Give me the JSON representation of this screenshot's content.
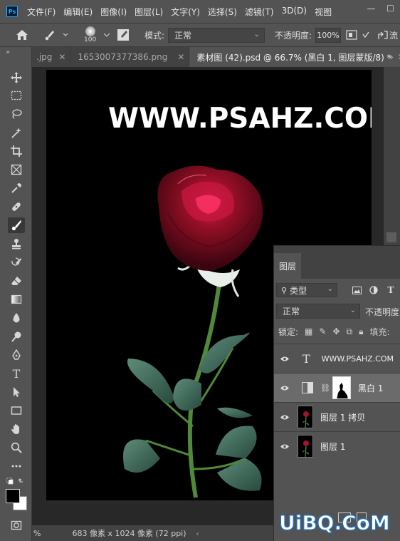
{
  "app": {
    "logo_text": "Ps",
    "menu": [
      "文件(F)",
      "编辑(E)",
      "图像(I)",
      "图层(L)",
      "文字(Y)",
      "选择(S)",
      "滤镜(T)",
      "3D(D)",
      "视图"
    ],
    "window_controls": {
      "minimize": "—",
      "maximize": "☐"
    }
  },
  "options_bar": {
    "brush_size": "100",
    "mode_label": "模式:",
    "mode_value": "正常",
    "opacity_label": "不透明度:",
    "opacity_value": "100%",
    "flow_label": "流"
  },
  "tabs": [
    {
      "label": ".jpg",
      "active": false
    },
    {
      "label": "1653007377386.png",
      "active": false
    },
    {
      "label": "素材图 (42).psd @ 66.7% (黑白 1, 图层蒙版/8) *",
      "active": true
    }
  ],
  "tab_more": "»",
  "canvas": {
    "watermark": "WWW.PSAHZ.COM"
  },
  "status": {
    "zoom_suffix": "%",
    "doc_size": "683 像素 x 1024 像素 (72 ppi)",
    "arrow": "‹"
  },
  "layers_panel": {
    "tab_label": "图层",
    "filter_value": "类型",
    "blend_mode": "正常",
    "opacity_label": "不透明度:",
    "lock_label": "锁定:",
    "fill_label": "填充:",
    "layers": [
      {
        "name": "WWW.PSAHZ.COM",
        "kind": "text",
        "selected": false
      },
      {
        "name": "黑白 1",
        "kind": "adjustment",
        "selected": true
      },
      {
        "name": "图层 1 拷贝",
        "kind": "pixel",
        "selected": false
      },
      {
        "name": "图层 1",
        "kind": "pixel",
        "selected": false
      }
    ]
  },
  "site_logo": "UiBQ.CoM",
  "colors": {
    "panel_bg": "#535353",
    "canvas_bg": "#000000",
    "rose": "#8b0f22",
    "leaf": "#3e6b5a",
    "stem": "#4a7a3a",
    "selected_row": "#6b6b6b"
  }
}
